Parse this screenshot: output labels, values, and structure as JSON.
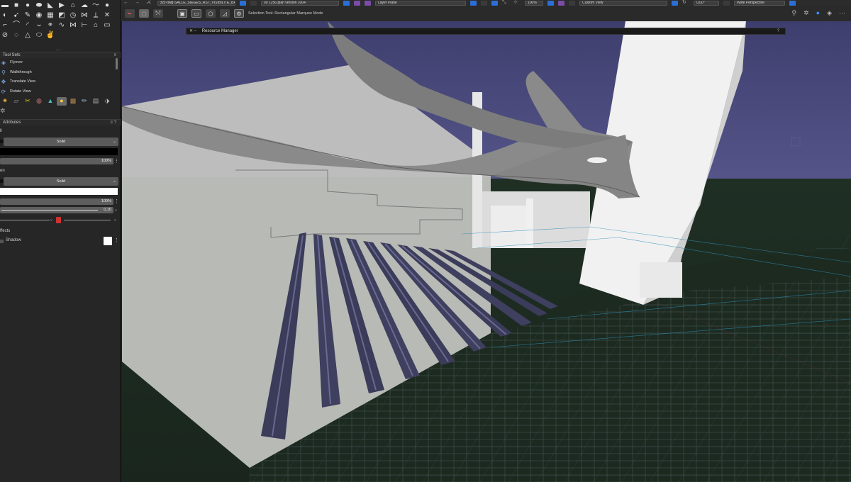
{
  "topbar": {
    "class_select": "zzz-dwg-SALLE_SIEGES_RST_VISIBILITE_BAL...",
    "layer_select": "00 1256 plan version 2004",
    "layer_plane": "Layer Plane",
    "zoom": "100%",
    "view": "Custom View",
    "rotation": "0,00°",
    "projection": "Wide Perspective"
  },
  "modebar": {
    "tool_status": "Selection Tool: Rectangular Marquee Mode"
  },
  "palette": {
    "toolsets_title": "Tool Sets",
    "toolsets": [
      {
        "label": "Flyover",
        "icon": "flyover-icon"
      },
      {
        "label": "Walkthrough",
        "icon": "walkthrough-icon"
      },
      {
        "label": "Translate View",
        "icon": "translate-view-icon"
      },
      {
        "label": "Rotate View",
        "icon": "rotate-view-icon"
      }
    ],
    "attributes_title": "Attributes",
    "fill_label": "ll",
    "fill_style": "Solid",
    "fill_color": "#000000",
    "fill_opacity": "100%",
    "pen_label": "en",
    "pen_style": "Solid",
    "pen_color": "#ffffff",
    "pen_opacity": "100%",
    "line_weight": "0,10",
    "effects_title": "ffects",
    "shadow_label": "Shadow"
  },
  "resource_manager": {
    "title": "Resource Manager",
    "help": "?"
  },
  "colors": {
    "sky": "#4b4b7e",
    "ground": "#1f2b22",
    "panel": "#262626",
    "accent": "#2b6fd6"
  }
}
